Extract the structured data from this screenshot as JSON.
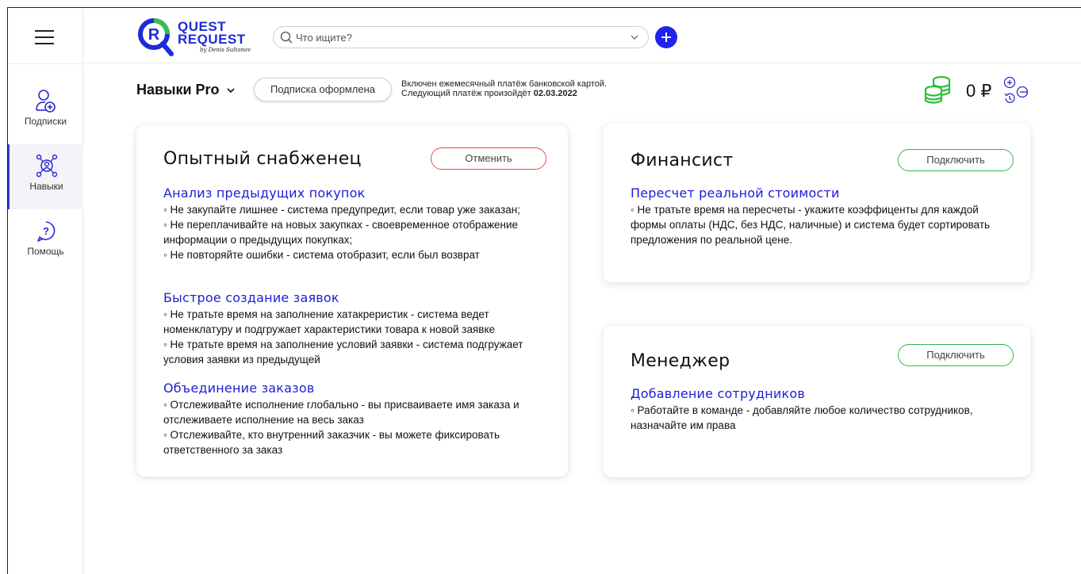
{
  "header": {
    "logo_line1": "QUEST",
    "logo_line2": "REQUEST",
    "logo_by": "by Denis Sultanov",
    "search_placeholder": "Что ищите?"
  },
  "sidebar": {
    "items": [
      {
        "label": "Подписки",
        "icon": "user-add-icon",
        "active": false
      },
      {
        "label": "Навыки",
        "icon": "network-users-icon",
        "active": true
      },
      {
        "label": "Помощь",
        "icon": "help-circle-icon",
        "active": false
      }
    ]
  },
  "subscription": {
    "plan_name": "Навыки Pro",
    "status_pill": "Подписка оформлена",
    "info_line1": "Включен ежемесячный платёж банковской картой.",
    "info_line2_prefix": "Следующий платёж произойдёт ",
    "next_payment_date": "02.03.2022",
    "balance": "0 ₽"
  },
  "cards": [
    {
      "title": "Опытный снабженец",
      "button": "Отменить",
      "features": [
        {
          "title": "Анализ предыдущих покупок",
          "lines": [
            "◦ Не закупайте лишнее - система предупредит, если товар уже заказан;",
            "◦ Не переплачивайте на новых закупках - своевременное отображение информации о предыдущих покупках;",
            "◦ Не повторяйте ошибки - система отобразит, если был возврат"
          ]
        },
        {
          "title": "Быстрое создание заявок",
          "lines": [
            "◦ Не тратьте время на заполнение хатакреристик - система ведет номенклатуру и подгружает характеристики товара к новой заявке",
            "◦ Не тратьте время на заполнение условий заявки - система подгружает условия заявки из предыдущей"
          ]
        },
        {
          "title": "Объединение заказов",
          "lines": [
            "◦ Отслеживайте исполнение глобально - вы присваиваете имя заказа и отслеживаете исполнение на весь заказ",
            "◦ Отслеживайте, кто внутренний заказчик - вы можете фиксировать ответственного за заказ"
          ]
        }
      ]
    },
    {
      "title": "Финансист",
      "button": "Подключить",
      "features": [
        {
          "title": "Пересчет реальной стоимости",
          "lines": [
            "◦ Не тратьте время на пересчеты - укажите коэффиценты для каждой формы оплаты (НДС, без НДС, наличные) и система будет сортировать предложения по реальной цене."
          ]
        }
      ]
    },
    {
      "title": "Менеджер",
      "button": "Подключить",
      "features": [
        {
          "title": "Добавление сотрудников",
          "lines": [
            "◦ Работайте в команде - добавляйте любое количество сотрудников, назначайте им права"
          ]
        }
      ]
    }
  ],
  "colors": {
    "accent": "#1d1dd8",
    "cancel_border": "#e0533a",
    "connect_border": "#3bb54a",
    "coins": "#2fbf3a"
  }
}
